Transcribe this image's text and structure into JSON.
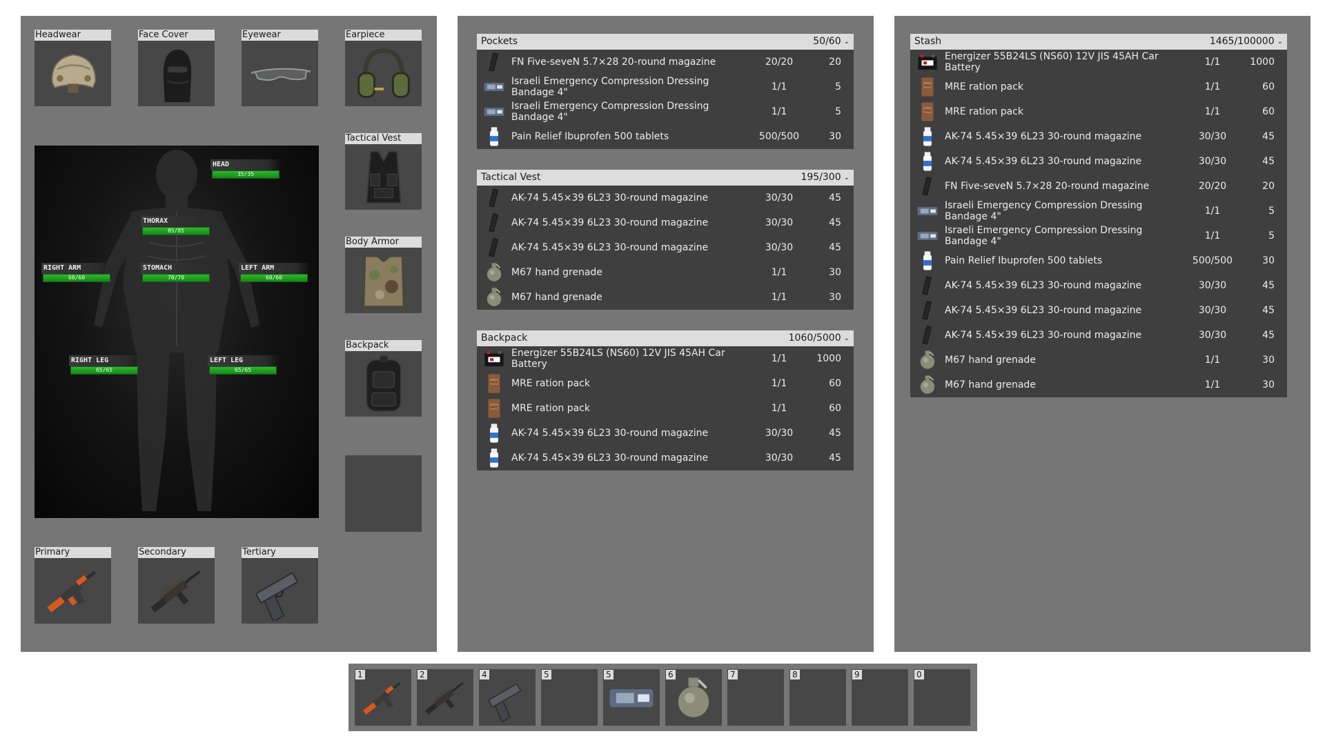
{
  "equipment": {
    "headwear": {
      "label": "Headwear",
      "icon": "helmet-icon"
    },
    "face_cover": {
      "label": "Face Cover",
      "icon": "balaclava-icon"
    },
    "eyewear": {
      "label": "Eyewear",
      "icon": "glasses-icon"
    },
    "earpiece": {
      "label": "Earpiece",
      "icon": "headset-icon"
    },
    "tactical_vest": {
      "label": "Tactical Vest",
      "icon": "vest-icon"
    },
    "body_armor": {
      "label": "Body Armor",
      "icon": "armor-icon"
    },
    "backpack": {
      "label": "Backpack",
      "icon": "backpack-icon"
    },
    "primary": {
      "label": "Primary",
      "icon": "ak-rifle-icon"
    },
    "secondary": {
      "label": "Secondary",
      "icon": "assault-rifle-icon"
    },
    "tertiary": {
      "label": "Tertiary",
      "icon": "pistol-icon"
    }
  },
  "health": {
    "head": {
      "name": "HEAD",
      "value": "35/35",
      "fraction": 1.0
    },
    "thorax": {
      "name": "THORAX",
      "value": "85/85",
      "fraction": 1.0
    },
    "right_arm": {
      "name": "RIGHT ARM",
      "value": "60/60",
      "fraction": 1.0
    },
    "stomach": {
      "name": "STOMACH",
      "value": "70/70",
      "fraction": 1.0
    },
    "left_arm": {
      "name": "LEFT ARM",
      "value": "60/60",
      "fraction": 1.0
    },
    "right_leg": {
      "name": "RIGHT LEG",
      "value": "65/65",
      "fraction": 1.0
    },
    "left_leg": {
      "name": "LEFT LEG",
      "value": "65/65",
      "fraction": 1.0
    }
  },
  "containers": {
    "pockets": {
      "title": "Pockets",
      "capacity": "50/60",
      "chevron": "⌄",
      "items": [
        {
          "icon": "magazine-icon",
          "name": "FN Five-seveN 5.7×28 20-round magazine",
          "count": "20/20",
          "weight": "20"
        },
        {
          "icon": "bandage-icon",
          "name": "Israeli Emergency Compression Dressing Bandage 4\"",
          "count": "1/1",
          "weight": "5"
        },
        {
          "icon": "bandage-icon",
          "name": "Israeli Emergency Compression Dressing Bandage 4\"",
          "count": "1/1",
          "weight": "5"
        },
        {
          "icon": "pill-bottle-icon",
          "name": "Pain Relief Ibuprofen 500 tablets",
          "count": "500/500",
          "weight": "30"
        }
      ]
    },
    "tactical_vest": {
      "title": "Tactical Vest",
      "capacity": "195/300",
      "chevron": "⌄",
      "items": [
        {
          "icon": "magazine-icon",
          "name": "AK-74 5.45×39 6L23 30-round magazine",
          "count": "30/30",
          "weight": "45"
        },
        {
          "icon": "magazine-icon",
          "name": "AK-74 5.45×39 6L23 30-round magazine",
          "count": "30/30",
          "weight": "45"
        },
        {
          "icon": "magazine-icon",
          "name": "AK-74 5.45×39 6L23 30-round magazine",
          "count": "30/30",
          "weight": "45"
        },
        {
          "icon": "grenade-icon",
          "name": "M67 hand grenade",
          "count": "1/1",
          "weight": "30"
        },
        {
          "icon": "grenade-icon",
          "name": "M67 hand grenade",
          "count": "1/1",
          "weight": "30"
        }
      ]
    },
    "backpack": {
      "title": "Backpack",
      "capacity": "1060/5000",
      "chevron": "⌄",
      "items": [
        {
          "icon": "battery-icon",
          "name": "Energizer 55B24LS (NS60) 12V JIS 45AH Car Battery",
          "count": "1/1",
          "weight": "1000"
        },
        {
          "icon": "mre-icon",
          "name": "MRE ration pack",
          "count": "1/1",
          "weight": "60"
        },
        {
          "icon": "mre-icon",
          "name": "MRE ration pack",
          "count": "1/1",
          "weight": "60"
        },
        {
          "icon": "pill-bottle-icon",
          "name": "AK-74 5.45×39 6L23 30-round magazine",
          "count": "30/30",
          "weight": "45"
        },
        {
          "icon": "pill-bottle-icon",
          "name": "AK-74 5.45×39 6L23 30-round magazine",
          "count": "30/30",
          "weight": "45"
        }
      ]
    },
    "stash": {
      "title": "Stash",
      "capacity": "1465/100000",
      "chevron": "⌄",
      "items": [
        {
          "icon": "battery-icon",
          "name": "Energizer 55B24LS (NS60) 12V JIS 45AH Car Battery",
          "count": "1/1",
          "weight": "1000"
        },
        {
          "icon": "mre-icon",
          "name": "MRE ration pack",
          "count": "1/1",
          "weight": "60"
        },
        {
          "icon": "mre-icon",
          "name": "MRE ration pack",
          "count": "1/1",
          "weight": "60"
        },
        {
          "icon": "pill-bottle-icon",
          "name": "AK-74 5.45×39 6L23 30-round magazine",
          "count": "30/30",
          "weight": "45"
        },
        {
          "icon": "pill-bottle-icon",
          "name": "AK-74 5.45×39 6L23 30-round magazine",
          "count": "30/30",
          "weight": "45"
        },
        {
          "icon": "magazine-icon",
          "name": "FN Five-seveN 5.7×28 20-round magazine",
          "count": "20/20",
          "weight": "20"
        },
        {
          "icon": "bandage-icon",
          "name": "Israeli Emergency Compression Dressing Bandage 4\"",
          "count": "1/1",
          "weight": "5"
        },
        {
          "icon": "bandage-icon",
          "name": "Israeli Emergency Compression Dressing Bandage 4\"",
          "count": "1/1",
          "weight": "5"
        },
        {
          "icon": "pill-bottle-icon",
          "name": "Pain Relief Ibuprofen 500 tablets",
          "count": "500/500",
          "weight": "30"
        },
        {
          "icon": "magazine-icon",
          "name": "AK-74 5.45×39 6L23 30-round magazine",
          "count": "30/30",
          "weight": "45"
        },
        {
          "icon": "magazine-icon",
          "name": "AK-74 5.45×39 6L23 30-round magazine",
          "count": "30/30",
          "weight": "45"
        },
        {
          "icon": "magazine-icon",
          "name": "AK-74 5.45×39 6L23 30-round magazine",
          "count": "30/30",
          "weight": "45"
        },
        {
          "icon": "grenade-icon",
          "name": "M67 hand grenade",
          "count": "1/1",
          "weight": "30"
        },
        {
          "icon": "grenade-icon",
          "name": "M67 hand grenade",
          "count": "1/1",
          "weight": "30"
        }
      ]
    }
  },
  "hotbar": [
    {
      "key": "1",
      "icon": "ak-rifle-icon"
    },
    {
      "key": "2",
      "icon": "assault-rifle-icon"
    },
    {
      "key": "4",
      "icon": "pistol-icon"
    },
    {
      "key": "5",
      "icon": ""
    },
    {
      "key": "5",
      "icon": "bandage-icon"
    },
    {
      "key": "6",
      "icon": "grenade-icon"
    },
    {
      "key": "7",
      "icon": ""
    },
    {
      "key": "8",
      "icon": ""
    },
    {
      "key": "9",
      "icon": ""
    },
    {
      "key": "0",
      "icon": ""
    }
  ],
  "colors": {
    "panel": "#767676",
    "slot": "#474747",
    "header": "#dcdcdc",
    "health_green": "#2fb52f"
  }
}
